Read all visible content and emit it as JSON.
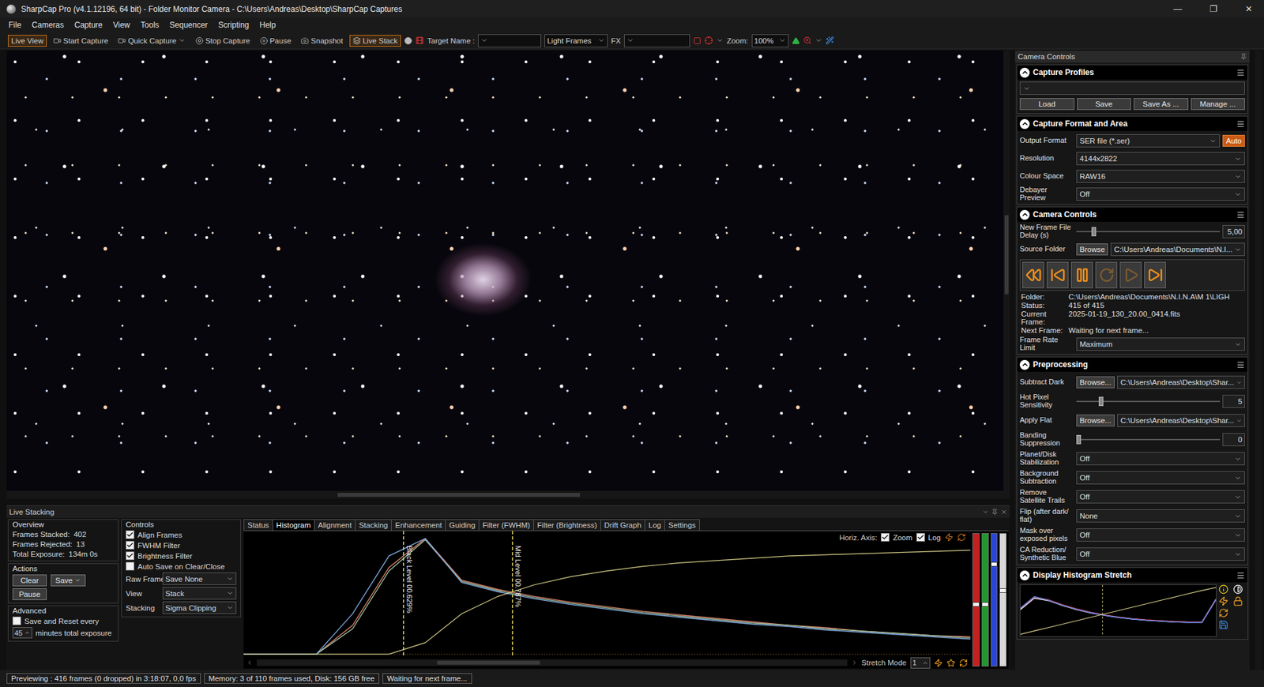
{
  "window": {
    "title": "SharpCap Pro (v4.1.12196, 64 bit) - Folder Monitor Camera - C:\\Users\\Andreas\\Desktop\\SharpCap Captures",
    "controls": [
      "—",
      "❐",
      "✕"
    ]
  },
  "menu": [
    "File",
    "Cameras",
    "Capture",
    "View",
    "Tools",
    "Sequencer",
    "Scripting",
    "Help"
  ],
  "toolbar": {
    "live_view": {
      "label": "Live View",
      "selected": true
    },
    "buttons": [
      {
        "label": "Start Capture",
        "has_menu": false
      },
      {
        "label": "Quick Capture",
        "has_menu": true
      },
      {
        "label": "Stop Capture",
        "has_menu": false
      },
      {
        "label": "Pause",
        "has_menu": false
      },
      {
        "label": "Snapshot",
        "has_menu": false
      }
    ],
    "live_stack": {
      "label": "Live Stack",
      "selected": true
    },
    "target_label": "Target Name :",
    "target_value": "",
    "frame_type": "Light Frames",
    "fx_label": "FX",
    "fx_value": "",
    "zoom_label": "Zoom:",
    "zoom_value": "100%"
  },
  "side_panel": {
    "title": "Camera Controls",
    "capture_profiles": {
      "title": "Capture Profiles",
      "expanded": true,
      "profile": "",
      "buttons": [
        "Load",
        "Save",
        "Save As ...",
        "Manage ..."
      ]
    },
    "capture_format": {
      "title": "Capture Format and Area",
      "expanded": true,
      "rows": [
        {
          "label": "Output Format",
          "value": "SER file (*.ser)",
          "button": "Auto"
        },
        {
          "label": "Resolution",
          "value": "4144x2822",
          "button": ""
        },
        {
          "label": "Colour Space",
          "value": "RAW16",
          "button": ""
        },
        {
          "label": "Debayer Preview",
          "value": "Off",
          "button": ""
        }
      ]
    },
    "camera_controls": {
      "title": "Camera Controls",
      "expanded": true,
      "delay": {
        "label": "New Frame File Delay (s)",
        "level": 0.12,
        "value": "5,00"
      },
      "source": {
        "label": "Source Folder",
        "button": "Browse",
        "value": "C:\\Users\\Andreas\\Documents\\N.I..."
      },
      "playback": [
        {
          "disabled": false
        },
        {
          "disabled": false
        },
        {
          "disabled": false
        },
        {
          "disabled": true
        },
        {
          "disabled": true
        },
        {
          "disabled": false
        }
      ],
      "info": [
        {
          "label": "Folder:",
          "value": "C:\\Users\\Andreas\\Documents\\N.I.N.A\\M 1\\LIGH"
        },
        {
          "label": "Status:",
          "value": "415 of 415"
        },
        {
          "label": "Current Frame:",
          "value": "2025-01-19_130_20.00_0414.fits"
        },
        {
          "label": "Next Frame:",
          "value": "Waiting for next frame..."
        }
      ],
      "frame_rate": {
        "label": "Frame Rate Limit",
        "value": "Maximum"
      }
    },
    "preprocessing": {
      "title": "Preprocessing",
      "expanded": true,
      "rows": [
        {
          "kind": "file",
          "label": "Subtract Dark",
          "button": "Browse...",
          "value": "C:\\Users\\Andreas\\Desktop\\Shar..."
        },
        {
          "kind": "slider",
          "label": "Hot Pixel Sensitivity",
          "level": 0.17,
          "value": "5"
        },
        {
          "kind": "file",
          "label": "Apply Flat",
          "button": "Browse...",
          "value": "C:\\Users\\Andreas\\Desktop\\Shar..."
        },
        {
          "kind": "slider",
          "label": "Banding Suppression",
          "level": 0,
          "value": "0"
        },
        {
          "kind": "select",
          "label": "Planet/Disk Stabilization",
          "value": "Off"
        },
        {
          "kind": "select",
          "label": "Background Subtraction",
          "value": "Off"
        },
        {
          "kind": "select",
          "label": "Remove Satellite Trails",
          "value": "Off"
        },
        {
          "kind": "select",
          "label": "Flip (after dark/ flat)",
          "value": "None"
        },
        {
          "kind": "select",
          "label": "Mask over exposed pixels",
          "value": "Off"
        },
        {
          "kind": "select",
          "label": "CA Reduction/ Synthetic Blue",
          "value": "Off"
        }
      ]
    },
    "display_stretch": {
      "title": "Display Histogram Stretch",
      "expanded": true,
      "series": [
        {
          "color": "#e04848",
          "values": [
            0.62,
            0.9,
            0.84,
            0.72,
            0.62,
            0.54,
            0.47,
            0.42,
            0.38,
            0.35,
            0.33,
            0.31,
            0.3,
            0.3,
            0.86
          ]
        },
        {
          "color": "#e8e8e8",
          "values": [
            0.6,
            0.88,
            0.82,
            0.7,
            0.6,
            0.52,
            0.46,
            0.41,
            0.37,
            0.34,
            0.32,
            0.3,
            0.29,
            0.29,
            0.84
          ]
        },
        {
          "color": "#5a78e8",
          "values": [
            0.64,
            0.92,
            0.83,
            0.71,
            0.61,
            0.53,
            0.46,
            0.41,
            0.37,
            0.34,
            0.32,
            0.3,
            0.29,
            0.29,
            0.85
          ]
        }
      ],
      "curve": [
        0.02,
        0.1,
        0.18,
        0.26,
        0.34,
        0.42,
        0.5,
        0.58,
        0.66,
        0.74,
        0.82,
        0.9,
        0.97
      ],
      "marker": 0.42
    }
  },
  "live_stacking": {
    "title": "Live Stacking",
    "overview": {
      "title": "Overview",
      "rows": [
        {
          "label": "Frames Stacked:",
          "value": "402"
        },
        {
          "label": "Frames Rejected:",
          "value": "13"
        },
        {
          "label": "Total Exposure:",
          "value": "134m 0s"
        }
      ]
    },
    "actions": {
      "title": "Actions",
      "buttons": [
        {
          "label": "Clear",
          "has_menu": false
        },
        {
          "label": "Save",
          "has_menu": true
        },
        {
          "label": "Pause",
          "has_menu": false
        }
      ]
    },
    "advanced": {
      "title": "Advanced",
      "checkbox": {
        "label": "Save and Reset every",
        "checked": false
      },
      "minutes": "45",
      "suffix": "minutes total exposure"
    },
    "controls": {
      "title": "Controls",
      "checkboxes": [
        {
          "label": "Align Frames",
          "checked": true
        },
        {
          "label": "FWHM Filter",
          "checked": true
        },
        {
          "label": "Brightness Filter",
          "checked": true
        },
        {
          "label": "Auto Save on Clear/Close",
          "checked": false
        }
      ],
      "selects": [
        {
          "label": "Raw Frames",
          "value": "Save None"
        },
        {
          "label": "View",
          "value": "Stack"
        },
        {
          "label": "Stacking",
          "value": "Sigma Clipping"
        }
      ]
    },
    "tabs": [
      {
        "label": "Status",
        "selected": false
      },
      {
        "label": "Histogram",
        "selected": true
      },
      {
        "label": "Alignment",
        "selected": false
      },
      {
        "label": "Stacking",
        "selected": false
      },
      {
        "label": "Enhancement",
        "selected": false
      },
      {
        "label": "Guiding",
        "selected": false
      },
      {
        "label": "Filter (FWHM)",
        "selected": false
      },
      {
        "label": "Filter (Brightness)",
        "selected": false
      },
      {
        "label": "Drift Graph",
        "selected": false
      },
      {
        "label": "Log",
        "selected": false
      },
      {
        "label": "Settings",
        "selected": false
      }
    ],
    "histogram": {
      "axis_label": "Horiz. Axis:",
      "options": [
        {
          "label": "Zoom",
          "checked": true
        },
        {
          "label": "Log",
          "checked": true
        }
      ],
      "series": [
        {
          "color": "#d9826a",
          "values": [
            0,
            0,
            0,
            0.25,
            0.75,
            1,
            0.64,
            0.56,
            0.5,
            0.45,
            0.41,
            0.37,
            0.34,
            0.31,
            0.28,
            0.25,
            0.23,
            0.2,
            0.18,
            0.16,
            0.15
          ]
        },
        {
          "color": "#9fc0a0",
          "values": [
            0,
            0,
            0,
            0.22,
            0.72,
            0.99,
            0.63,
            0.55,
            0.49,
            0.44,
            0.4,
            0.36,
            0.33,
            0.3,
            0.27,
            0.25,
            0.22,
            0.2,
            0.18,
            0.16,
            0.14
          ]
        },
        {
          "color": "#7fa8e0",
          "values": [
            0,
            0,
            0,
            0.35,
            0.85,
            1,
            0.62,
            0.54,
            0.48,
            0.43,
            0.39,
            0.35,
            0.32,
            0.29,
            0.26,
            0.24,
            0.21,
            0.19,
            0.17,
            0.15,
            0.13
          ]
        }
      ],
      "stretch_curve": {
        "color": "#d8d08a",
        "values": [
          0,
          0,
          0,
          0,
          0,
          0.1,
          0.35,
          0.5,
          0.6,
          0.67,
          0.72,
          0.76,
          0.79,
          0.81,
          0.83,
          0.85,
          0.86,
          0.87,
          0.88,
          0.89,
          0.9
        ]
      },
      "markers": [
        {
          "label": "Black Level 00.629%",
          "value": 22
        },
        {
          "label": "Mid Level 00.787%",
          "value": 37
        }
      ],
      "sliders": [
        {
          "color": "#c42020",
          "level": 0.45
        },
        {
          "color": "#1f9a2a",
          "level": 0.45
        },
        {
          "color": "#2a46d8",
          "level": 0.75
        },
        {
          "color": "#d8d8d8",
          "level": 0.55
        }
      ],
      "stretch_mode_label": "Stretch Mode",
      "stretch_mode": "1"
    }
  },
  "status_bar": [
    "Previewing : 416 frames (0 dropped) in 3:18:07, 0,0 fps",
    "Memory: 3 of 110 frames used, Disk: 156 GB free",
    "Waiting for next frame..."
  ]
}
